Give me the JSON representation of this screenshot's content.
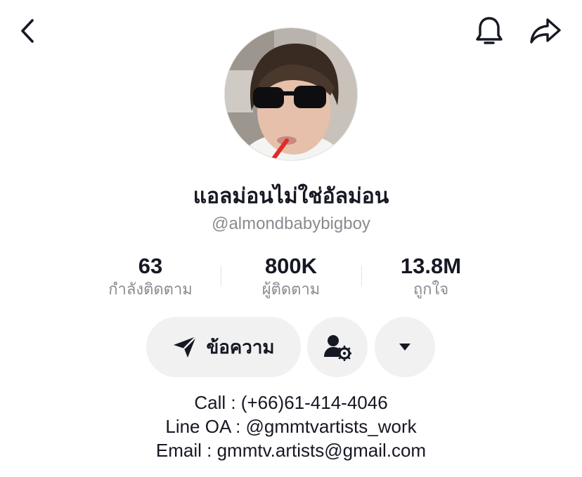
{
  "header": {
    "back_icon": "chevron-left-icon",
    "bell_icon": "bell-icon",
    "share_icon": "share-arrow-icon"
  },
  "profile": {
    "display_name": "แอลม่อนไม่ใช่อัลม่อน",
    "username": "@almondbabybigboy"
  },
  "stats": [
    {
      "value": "63",
      "label": "กำลังติดตาม"
    },
    {
      "value": "800K",
      "label": "ผู้ติดตาม"
    },
    {
      "value": "13.8M",
      "label": "ถูกใจ"
    }
  ],
  "actions": {
    "message_label": "ข้อความ",
    "message_icon": "send-icon",
    "friend_icon": "user-settings-icon",
    "more_icon": "caret-down-icon"
  },
  "bio": [
    "Call : (+66)61-414-4046",
    "Line OA : @gmmtvartists_work",
    "Email : gmmtv.artists@gmail.com"
  ],
  "colors": {
    "text": "#161823",
    "secondary": "#8a8b91",
    "button_bg": "#f1f1f2"
  }
}
